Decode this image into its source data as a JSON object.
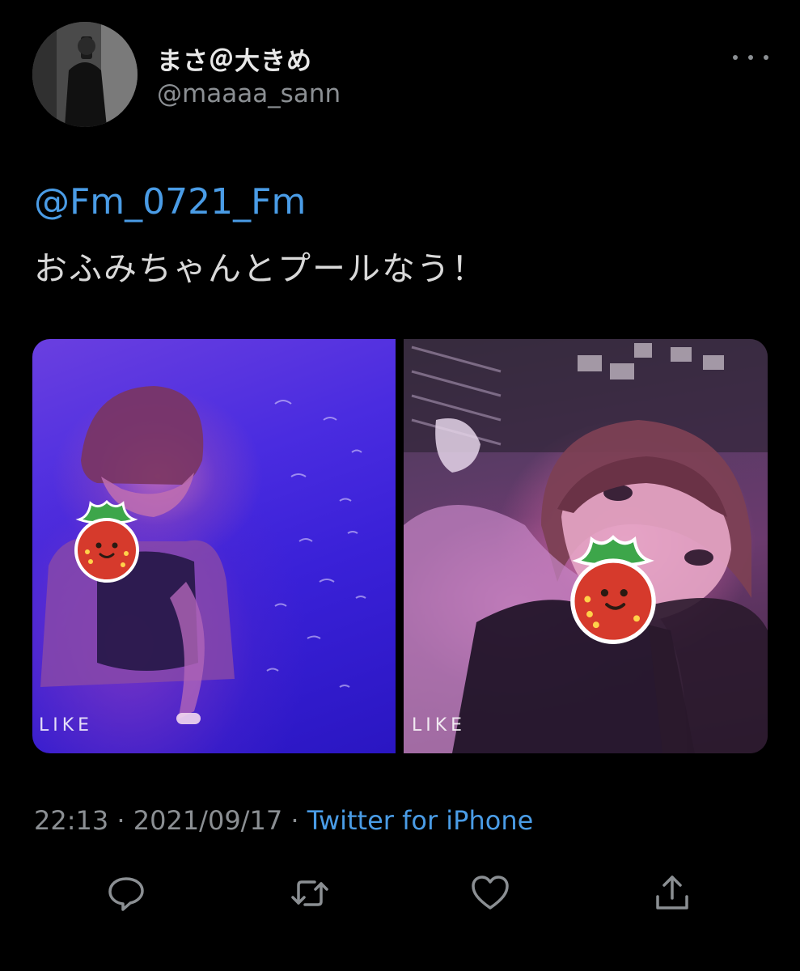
{
  "tweet": {
    "display_name": "まさ＠大きめ",
    "handle": "@maaaa_sann",
    "mention": "@Fm_0721_Fm",
    "text": "おふみちゃんとプールなう！",
    "media": [
      {
        "watermark": "LIKE",
        "alt": "photo-1"
      },
      {
        "watermark": "LIKE",
        "alt": "photo-2"
      }
    ],
    "time": "22:13",
    "separator": "·",
    "date": "2021/09/17",
    "source": "Twitter for iPhone"
  },
  "actions": [
    {
      "name": "reply",
      "icon": "reply-icon"
    },
    {
      "name": "retweet",
      "icon": "retweet-icon"
    },
    {
      "name": "like",
      "icon": "heart-icon"
    },
    {
      "name": "share",
      "icon": "share-icon"
    }
  ],
  "colors": {
    "background": "#000000",
    "link": "#4a9ce6",
    "secondary_text": "#8b8f93",
    "primary_text": "#d9d9d9"
  }
}
